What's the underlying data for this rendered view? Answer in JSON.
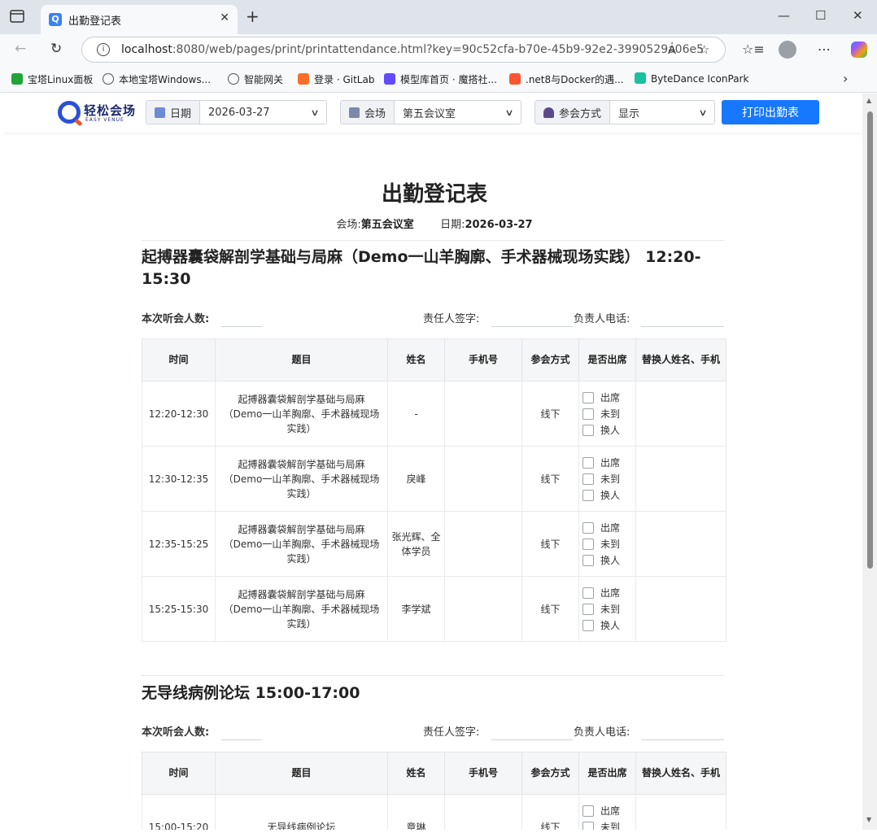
{
  "browser": {
    "tab_title": "出勤登记表",
    "tab_favicon_letter": "Q",
    "url_host": "localhost",
    "url_rest": ":8080/web/pages/print/printattendance.html?key=90c52cfa-b70e-45b9-92e2-3990529a06e5",
    "bookmarks": [
      {
        "label": "宝塔Linux面板",
        "icon": "shield-icon",
        "color": "#20a53a"
      },
      {
        "label": "本地宝塔Windows...",
        "icon": "globe-icon",
        "color": "#555555"
      },
      {
        "label": "智能网关",
        "icon": "globe-icon",
        "color": "#555555"
      },
      {
        "label": "登录 · GitLab",
        "icon": "gitlab-icon",
        "color": "#fc6d26"
      },
      {
        "label": "模型库首页 · 魔搭社...",
        "icon": "modelscope-icon",
        "color": "#624aff"
      },
      {
        "label": ".net8与Docker的遇...",
        "icon": "csdn-icon",
        "color": "#fc5531"
      },
      {
        "label": "ByteDance IconPark",
        "icon": "iconpark-icon",
        "color": "#18c29c"
      }
    ]
  },
  "app": {
    "logo_main": "轻松会场",
    "logo_sub": "EASY VENUE",
    "filters": {
      "date_label": "日期",
      "date_value": "2026-03-27",
      "venue_label": "会场",
      "venue_value": "第五会议室",
      "mode_label": "参会方式",
      "mode_value": "显示"
    },
    "print_button": "打印出勤表"
  },
  "document": {
    "title": "出勤登记表",
    "venue_label": "会场:",
    "venue_value": "第五会议室",
    "date_label": "日期:",
    "date_value": "2026-03-27",
    "sign_labels": {
      "count": "本次听会人数:",
      "signer": "责任人签字:",
      "phone": "负责人电话:"
    },
    "table_headers": [
      "时间",
      "题目",
      "姓名",
      "手机号",
      "参会方式",
      "是否出席",
      "替换人姓名、手机"
    ],
    "attendance_options": [
      "出席",
      "未到",
      "换人"
    ],
    "sessions": [
      {
        "title": "起搏器囊袋解剖学基础与局麻（Demo一山羊胸廓、手术器械现场实践） 12:20-15:30",
        "rows": [
          {
            "time": "12:20-12:30",
            "topic": "起搏器囊袋解剖学基础与局麻（Demo一山羊胸廓、手术器械现场实践）",
            "name": "-",
            "phone": "",
            "mode": "线下",
            "replacement": ""
          },
          {
            "time": "12:30-12:35",
            "topic": "起搏器囊袋解剖学基础与局麻（Demo一山羊胸廓、手术器械现场实践）",
            "name": "戾峰",
            "phone": "",
            "mode": "线下",
            "replacement": ""
          },
          {
            "time": "12:35-15:25",
            "topic": "起搏器囊袋解剖学基础与局麻（Demo一山羊胸廓、手术器械现场实践）",
            "name": "张光辉、全体学员",
            "phone": "",
            "mode": "线下",
            "replacement": ""
          },
          {
            "time": "15:25-15:30",
            "topic": "起搏器囊袋解剖学基础与局麻（Demo一山羊胸廓、手术器械现场实践）",
            "name": "李学斌",
            "phone": "",
            "mode": "线下",
            "replacement": ""
          }
        ]
      },
      {
        "title": "无导线病例论坛 15:00-17:00",
        "rows": [
          {
            "time": "15:00-15:20",
            "topic": "无导线病例论坛",
            "name": "章琳",
            "phone": "",
            "mode": "线下",
            "replacement": ""
          }
        ]
      }
    ]
  }
}
